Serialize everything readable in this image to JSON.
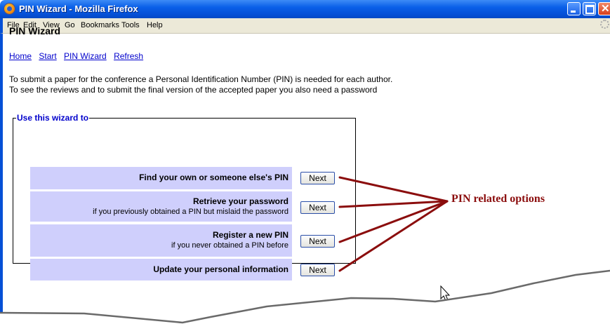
{
  "window": {
    "title": "PIN Wizard - Mozilla Firefox",
    "menu": [
      "File",
      "Edit",
      "View",
      "Go",
      "Bookmarks",
      "Tools",
      "Help"
    ]
  },
  "page": {
    "title": "PIN Wizard",
    "nav": [
      "Home",
      "Start",
      "PIN Wizard",
      "Refresh"
    ],
    "intro": [
      "To submit a paper for the conference a Personal Identification Number (PIN) is needed for each author.",
      "To see the reviews and to submit the final version of the accepted paper you also need a password"
    ],
    "wizard": {
      "legend": "Use this wizard to",
      "options": [
        {
          "label": "Find your own or someone else's PIN",
          "sub": "",
          "button": "Next"
        },
        {
          "label": "Retrieve your password",
          "sub": "if you previously obtained a PIN but mislaid the password",
          "button": "Next"
        },
        {
          "label": "Register a new PIN",
          "sub": "if you never obtained a PIN before",
          "button": "Next"
        },
        {
          "label": "Update your personal information",
          "sub": "",
          "button": "Next"
        }
      ]
    }
  },
  "annotation": {
    "text": "PIN related options",
    "color": "#8b0d0d"
  },
  "colors": {
    "option_bg": "#cfcffc",
    "link": "#0000cc",
    "titlebar": "#0550d6"
  }
}
